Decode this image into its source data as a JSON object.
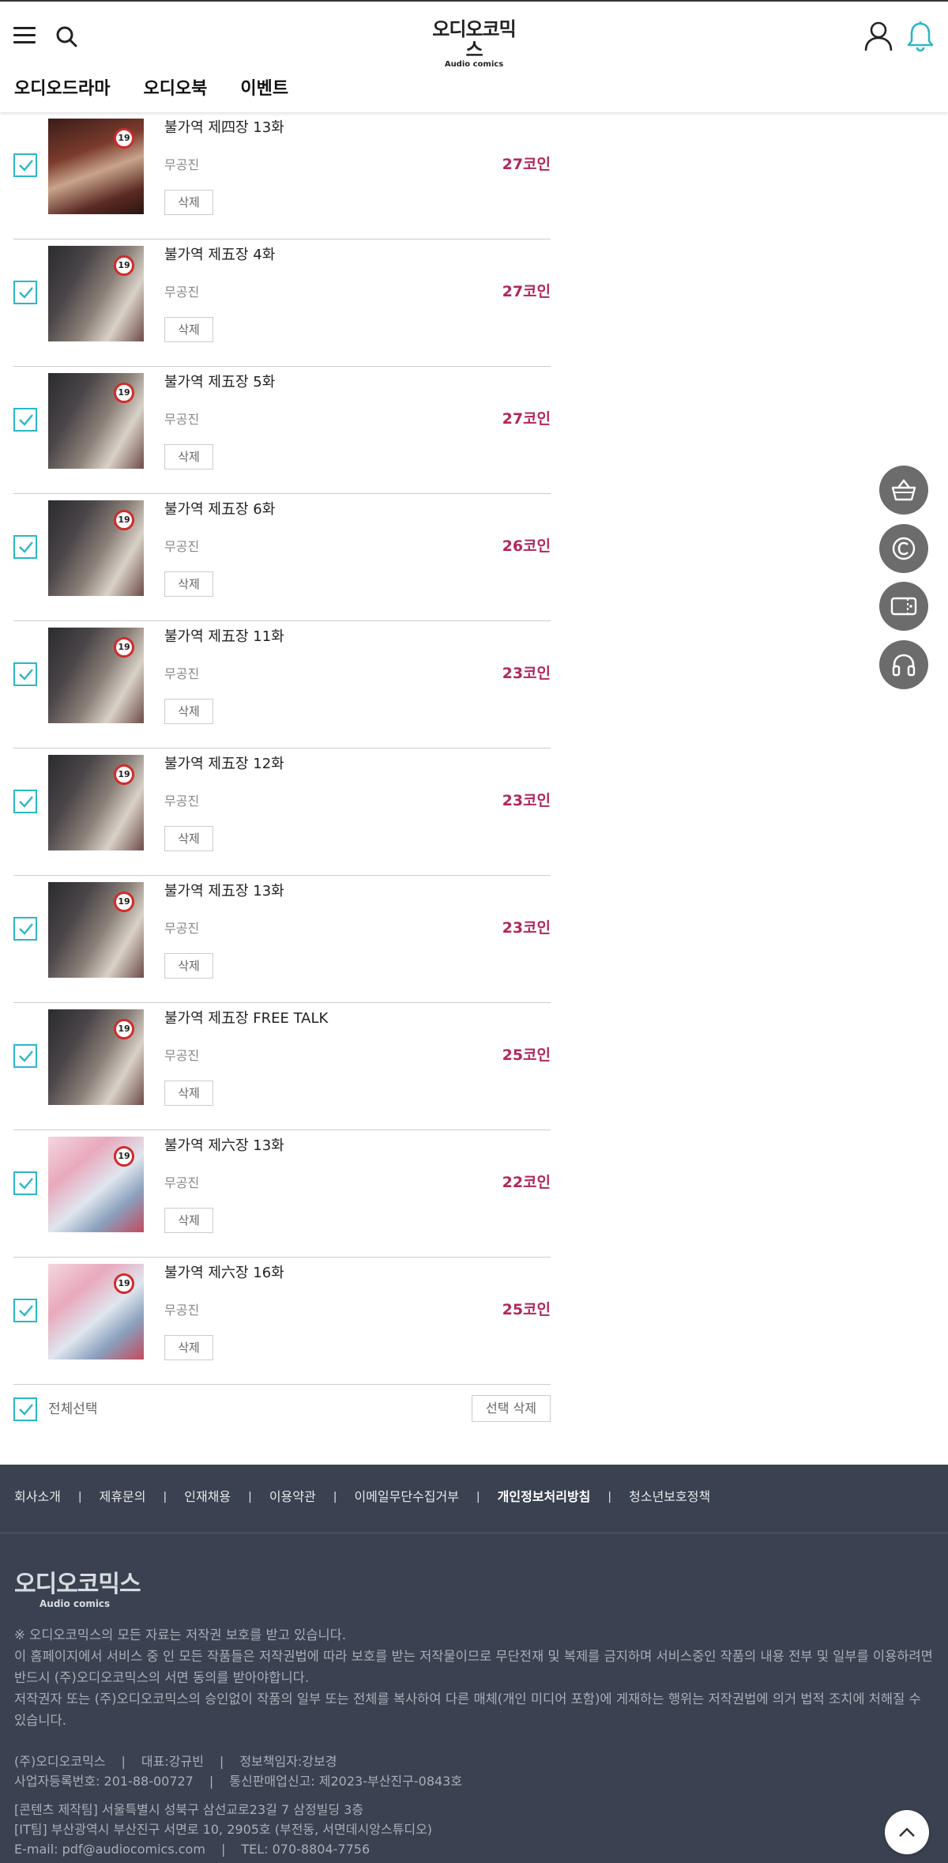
{
  "header": {
    "logo_main": "오디오코믹스",
    "logo_sub": "Audio comics",
    "menu_icon": "hamburger-menu-icon",
    "search_icon": "search-icon",
    "user_icon": "user-icon",
    "bell_icon": "bell-icon",
    "bell_color": "#2bb7c7"
  },
  "nav": {
    "items": [
      "오디오드라마",
      "오디오북",
      "이벤트"
    ]
  },
  "colors": {
    "accent": "#2bb7c7",
    "price": "#b0285e",
    "footer_bg": "#3a4150"
  },
  "cart": {
    "delete_label": "삭제",
    "items": [
      {
        "title": "불가역 제四장 13화",
        "author": "무공진",
        "price": "27코인",
        "checked": true,
        "cover": "dark",
        "badge": "19"
      },
      {
        "title": "불가역 제五장 4화",
        "author": "무공진",
        "price": "27코인",
        "checked": true,
        "cover": "grey",
        "badge": "19"
      },
      {
        "title": "불가역 제五장 5화",
        "author": "무공진",
        "price": "27코인",
        "checked": true,
        "cover": "grey",
        "badge": "19"
      },
      {
        "title": "불가역 제五장 6화",
        "author": "무공진",
        "price": "26코인",
        "checked": true,
        "cover": "grey",
        "badge": "19"
      },
      {
        "title": "불가역 제五장 11화",
        "author": "무공진",
        "price": "23코인",
        "checked": true,
        "cover": "grey",
        "badge": "19"
      },
      {
        "title": "불가역 제五장 12화",
        "author": "무공진",
        "price": "23코인",
        "checked": true,
        "cover": "grey",
        "badge": "19"
      },
      {
        "title": "불가역 제五장 13화",
        "author": "무공진",
        "price": "23코인",
        "checked": true,
        "cover": "grey",
        "badge": "19"
      },
      {
        "title": "불가역 제五장 FREE TALK",
        "author": "무공진",
        "price": "25코인",
        "checked": true,
        "cover": "grey",
        "badge": "19"
      },
      {
        "title": "불가역 제六장 13화",
        "author": "무공진",
        "price": "22코인",
        "checked": true,
        "cover": "pink",
        "badge": "19"
      },
      {
        "title": "불가역 제六장 16화",
        "author": "무공진",
        "price": "25코인",
        "checked": true,
        "cover": "pink",
        "badge": "19"
      }
    ],
    "select_all_label": "전체선택",
    "select_all_checked": true,
    "selected_delete_label": "선택 삭제"
  },
  "floating": {
    "buttons": [
      "basket-icon",
      "coin-icon",
      "ticket-icon",
      "headphones-icon"
    ],
    "top_icon": "chevron-up-icon"
  },
  "footer": {
    "links": [
      "회사소개",
      "제휴문의",
      "인재채용",
      "이용약관",
      "이메일무단수집거부",
      "개인정보처리방침",
      "청소년보호정책"
    ],
    "logo_main": "오디오코믹스",
    "logo_sub": "Audio comics",
    "notice_lines": [
      "※ 오디오코믹스의 모든 자료는 저작권 보호를 받고 있습니다.",
      "이 홈페이지에서 서비스 중 인 모든 작품들은 저작권법에 따라 보호를 받는 저작물이므로 무단전재 및 복제를 금지하며 서비스중인 작품의 내용 전부 및 일부를 이용하려면 반드시 (주)오디오코믹스의 서면 동의를 받아야합니다.",
      "저작권자 또는 (주)오디오코믹스의 승인없이 작품의 일부 또는 전체를 복사하여 다른 매체(개인 미디어 포함)에 게재하는 행위는 저작권법에 의거 법적 조치에 처해질 수 있습니다."
    ],
    "company": "(주)오디오코믹스",
    "ceo": "대표:강규빈",
    "privacy_officer": "정보책임자:강보경",
    "business_no": "사업자등록번호: 201-88-00727",
    "mail_order_no": "통신판매업신고: 제2023-부산진구-0843호",
    "content_team": "[콘텐츠 제작팀] 서울특별시 성북구 삼선교로23길 7 삼정빌딩 3층",
    "it_team": "[IT팀] 부산광역시 부산진구 서면로 10, 2905호 (부전동, 서면데시앙스튜디오)",
    "email": "E-mail: pdf@audiocomics.com",
    "tel": "TEL: 070-8804-7756"
  }
}
